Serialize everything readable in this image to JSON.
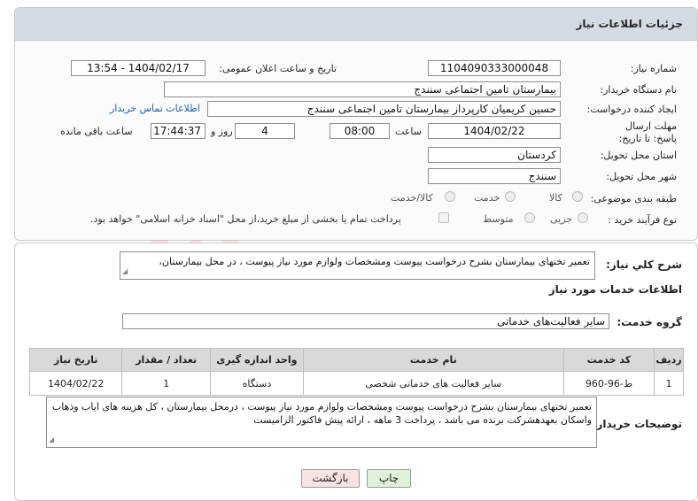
{
  "header": {
    "title": "جزئیات اطلاعات نیاز"
  },
  "fields": {
    "need_number_label": "شماره نیاز:",
    "need_number": "1104090333000048",
    "announce_label": "تاریخ و ساعت اعلان عمومی:",
    "announce_value": "1404/02/17 - 13:54",
    "buyer_org_label": "نام دستگاه خریدار:",
    "buyer_org": "بیمارستان تامین اجتماعی سنندج",
    "creator_label": "ایجاد کننده درخواست:",
    "creator": "حسین کریمیان کارپرداز بیمارستان تامین اجتماعی سنندج",
    "contact_link": "اطلاعات تماس خریدار",
    "deadline_label": "مهلت ارسال پاسخ: تا تاریخ:",
    "deadline_date": "1404/02/22",
    "time_label": "ساعت",
    "deadline_time": "08:00",
    "days_value": "4",
    "days_label": "روز و",
    "remaining_time": "17:44:37",
    "remaining_label": "ساعت باقی مانده",
    "province_label": "استان محل تحویل:",
    "province": "کردستان",
    "city_label": "شهر محل تحویل:",
    "city": "سنندج",
    "category_label": "طبقه بندی موضوعی:",
    "category_options": [
      "کالا",
      "خدمت",
      "کالا/خدمت"
    ],
    "process_label": "نوع فرآیند خرید :",
    "process_options": [
      "جزیی",
      "متوسط"
    ],
    "treasury_note": "پرداخت تمام یا بخشی از مبلغ خرید،از محل \"اسناد خزانه اسلامی\" خواهد بود."
  },
  "general": {
    "label": "شرح کلي نياز:",
    "text": "تعمیر تختهای بیمارستان  بشرح درخواست پیوست ومشخصات ولوازم مورد نیاز پیوست ، در محل بیمارستان،"
  },
  "services": {
    "section_title": "اطلاعات خدمات مورد نیاز",
    "group_label": "گروه خدمت:",
    "group_value": "سایر فعالیت‌های خدماتی",
    "headers": [
      "ردیف",
      "کد خدمت",
      "نام خدمت",
      "واحد اندازه گیری",
      "تعداد / مقدار",
      "تاریخ نیاز"
    ],
    "rows": [
      [
        "1",
        "ط-96-960",
        "سایر فعالیت های خدماتی شخصی",
        "دستگاه",
        "1",
        "1404/02/22"
      ]
    ]
  },
  "buyer_notes": {
    "label": "توضیحات خریدار:",
    "text": "تعمیر تختهای بیمارستان  بشرح درخواست پیوست ومشخصات ولوازم مورد نیاز پیوست ، درمحل بیمارستان ، کل هزینه های ایاب وذهاب واسکان بعهدهشرکت برنده می باشد ، پرداخت 3 ماهه ، ارائه پیش فاکتور الزامیست"
  },
  "buttons": {
    "print": "چاپ",
    "back": "بازگشت"
  },
  "colors": {
    "header_bg": "#d4dbe3",
    "link": "#1a5fb4",
    "print_btn": "#dff1d8",
    "back_btn": "#fbe3e3"
  },
  "watermark": {
    "text": "AriaTender.neT"
  }
}
